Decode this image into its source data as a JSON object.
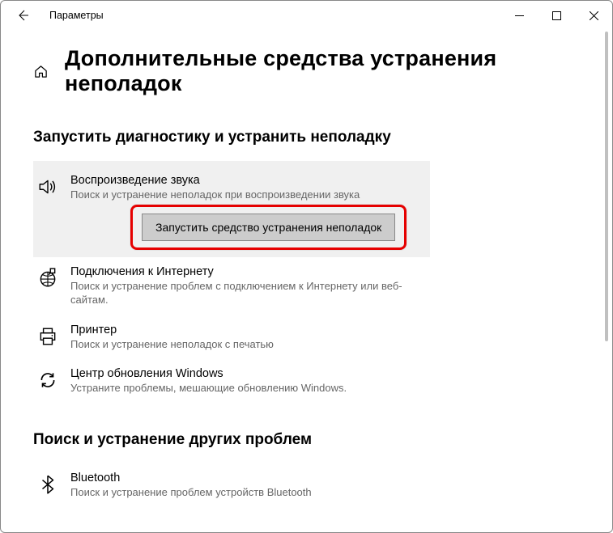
{
  "titlebar": {
    "title": "Параметры"
  },
  "page_title": "Дополнительные средства устранения неполадок",
  "section1_heading": "Запустить диагностику и устранить неполадку",
  "run_button": "Запустить средство устранения неполадок",
  "section2_heading": "Поиск и устранение других проблем",
  "items": [
    {
      "name": "Воспроизведение звука",
      "desc": "Поиск и устранение неполадок при воспроизведении звука"
    },
    {
      "name": "Подключения к Интернету",
      "desc": "Поиск и устранение проблем с подключением к Интернету или веб-сайтам."
    },
    {
      "name": "Принтер",
      "desc": "Поиск и устранение неполадок с печатью"
    },
    {
      "name": "Центр обновления Windows",
      "desc": "Устраните проблемы, мешающие обновлению Windows."
    }
  ],
  "items2": [
    {
      "name": "Bluetooth",
      "desc": "Поиск и устранение проблем устройств Bluetooth"
    }
  ]
}
